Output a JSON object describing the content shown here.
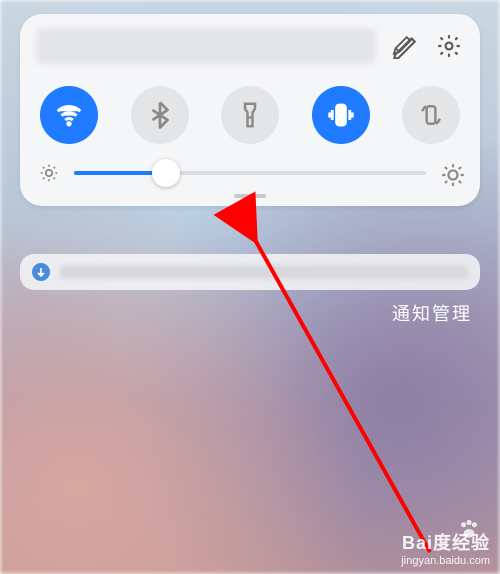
{
  "colors": {
    "accent": "#1f7bff"
  },
  "brightness": {
    "percent": 26
  },
  "toggles": {
    "wifi": true,
    "bluetooth": false,
    "flashlight": false,
    "vibrate": true,
    "rotate": false
  },
  "labels": {
    "notification_manage": "通知管理"
  },
  "watermark": {
    "brand": "Bai度经验",
    "url": "jingyan.baidu.com"
  }
}
